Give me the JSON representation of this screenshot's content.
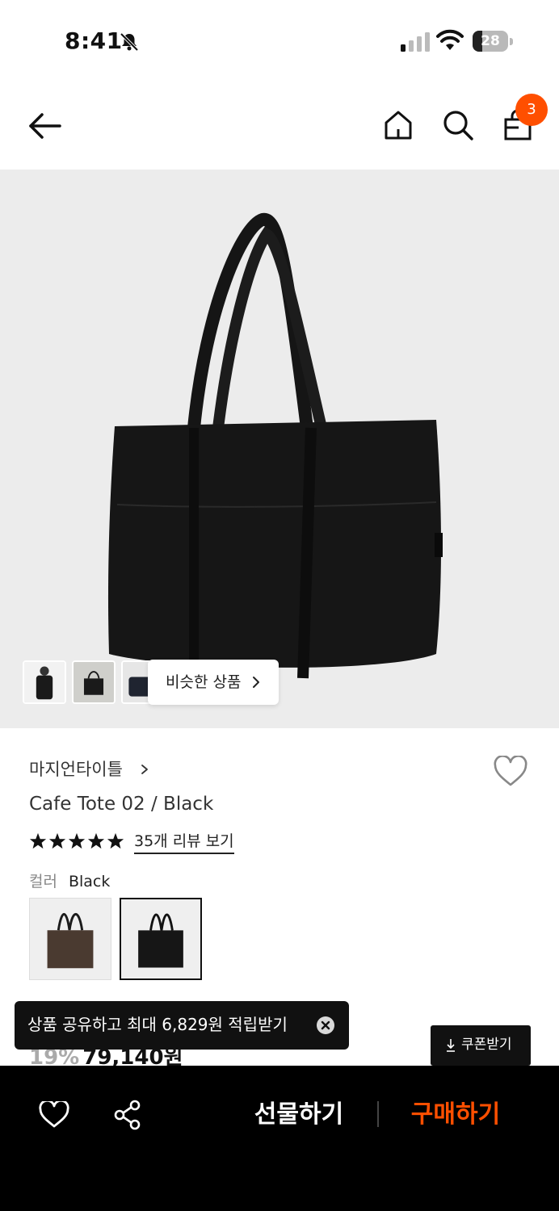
{
  "status_bar": {
    "time": "8:41",
    "battery": "28",
    "battery_level_percent": 28
  },
  "header": {
    "cart_count": "3"
  },
  "product_image": {
    "similar_label": "비슷한 상품"
  },
  "product": {
    "brand": "마지언타이틀",
    "name": "Cafe Tote 02 / Black",
    "rating_stars": 5,
    "review_link": "35개 리뷰 보기",
    "color_label": "컬러",
    "color_value": "Black",
    "discount": "19%",
    "price": "79,140원"
  },
  "toast": {
    "text": "상품 공유하고 최대 6,829원 적립받기"
  },
  "coupon": {
    "label": "쿠폰받기"
  },
  "bottom_bar": {
    "gift_label": "선물하기",
    "buy_label": "구매하기"
  },
  "colors": {
    "accent": "#ff4f00",
    "image_bg": "#ececec",
    "bar_bg": "#000000"
  }
}
